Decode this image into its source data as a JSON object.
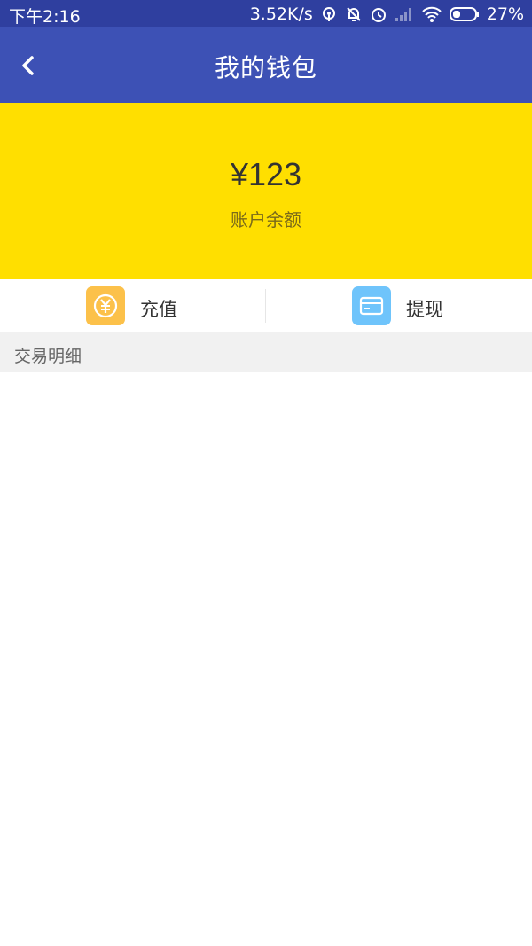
{
  "status_bar": {
    "time": "下午2:16",
    "network_speed": "3.52K/s",
    "battery": "27%"
  },
  "app_bar": {
    "title": "我的钱包"
  },
  "balance": {
    "amount": "¥123",
    "label": "账户余额"
  },
  "actions": {
    "recharge_label": "充值",
    "withdraw_label": "提现"
  },
  "transactions": {
    "header": "交易明细",
    "items": []
  },
  "colors": {
    "status_bar": "#2f3f9f",
    "app_bar": "#3d51b5",
    "balance_panel": "#ffdf00",
    "recharge_icon_bg": "#fcc14a",
    "withdraw_icon_bg": "#6fc4fb"
  },
  "icons": {
    "back": "chevron-left-icon",
    "recharge": "yen-coin-icon",
    "withdraw": "card-icon"
  }
}
